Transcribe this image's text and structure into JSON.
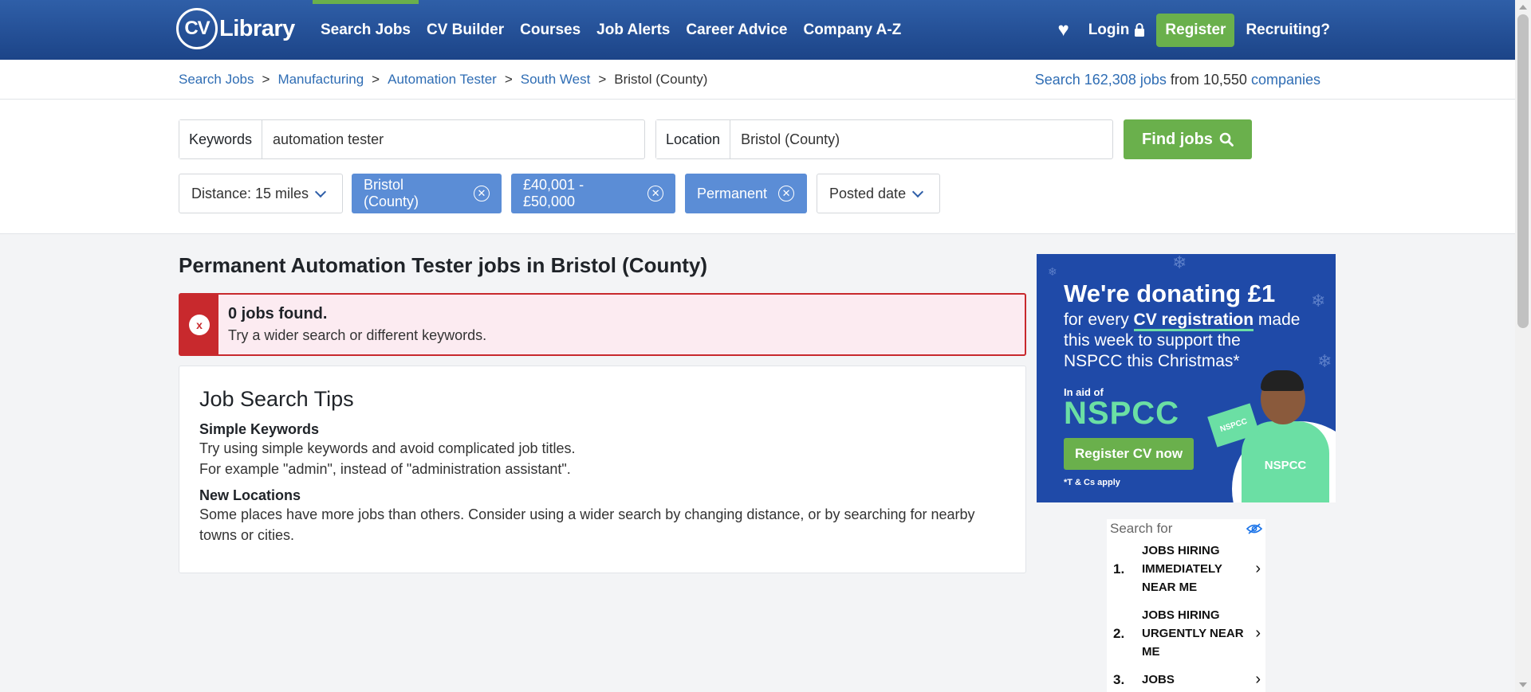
{
  "header": {
    "logo_cv": "CV",
    "logo_text": "Library",
    "nav": [
      "Search Jobs",
      "CV Builder",
      "Courses",
      "Job Alerts",
      "Career Advice",
      "Company A-Z"
    ],
    "login": "Login",
    "register": "Register",
    "recruiting": "Recruiting?"
  },
  "breadcrumb": {
    "items": [
      "Search Jobs",
      "Manufacturing",
      "Automation Tester",
      "South West"
    ],
    "current": "Bristol (County)"
  },
  "stats": {
    "prefix": "Search",
    "jobs": "162,308 jobs",
    "middle": "from 10,550",
    "companies": "companies"
  },
  "search": {
    "keywords_label": "Keywords",
    "keywords_value": "automation tester",
    "location_label": "Location",
    "location_value": "Bristol (County)",
    "find_button": "Find jobs"
  },
  "filters": {
    "distance": "Distance: 15 miles",
    "chips": [
      "Bristol (County)",
      "£40,001 - £50,000",
      "Permanent"
    ],
    "posted": "Posted date"
  },
  "results": {
    "title": "Permanent Automation Tester jobs in Bristol (County)",
    "alert_icon": "x",
    "alert_title": "0 jobs found.",
    "alert_text": "Try a wider search or different keywords."
  },
  "tips": {
    "heading": "Job Search Tips",
    "simple_title": "Simple Keywords",
    "simple_line1": "Try using simple keywords and avoid complicated job titles.",
    "simple_line2": "For example \"admin\", instead of \"administration assistant\".",
    "locations_title": "New Locations",
    "locations_text": "Some places have more jobs than others. Consider using a wider search by changing distance, or by searching for nearby towns or cities."
  },
  "promo": {
    "headline": "We're donating £1",
    "sub_pre": "for every",
    "sub_bold": "CV registration",
    "sub_post": "made this week to support the NSPCC this Christmas*",
    "aid": "In aid of",
    "charity": "NSPCC",
    "button": "Register CV now",
    "terms": "*T & Cs apply",
    "shirt": "NSPCC",
    "flag": "NSPCC"
  },
  "sponsored": {
    "label": "Search for",
    "items": [
      {
        "num": "1.",
        "text": "JOBS HIRING IMMEDIATELY NEAR ME"
      },
      {
        "num": "2.",
        "text": "JOBS HIRING URGENTLY NEAR ME"
      },
      {
        "num": "3.",
        "text": "JOBS"
      }
    ]
  },
  "colors": {
    "header": "#1c4488",
    "accent_green": "#6ab04c",
    "chip_blue": "#5b8dd6",
    "link": "#2f6db4",
    "error_red": "#c8292d",
    "error_bg": "#fcebf1"
  }
}
